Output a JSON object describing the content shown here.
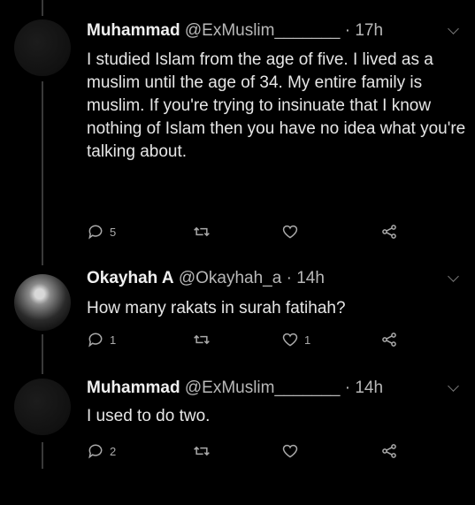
{
  "tweets": [
    {
      "name": "Muhammad",
      "handle": "@ExMuslim_______",
      "dot": "·",
      "time": "17h",
      "text": "I studied Islam from the age of five.  I lived as a muslim until the age of 34.  My entire family is muslim.  If you're trying to insinuate that I know nothing of Islam then you have no idea what you're talking about.",
      "reply_count": "5",
      "retweet_count": "",
      "like_count": ""
    },
    {
      "name": "Okayhah A",
      "handle": "@Okayhah_a",
      "dot": "·",
      "time": "14h",
      "text": "How many rakats in surah fatihah?",
      "reply_count": "1",
      "retweet_count": "",
      "like_count": "1"
    },
    {
      "name": "Muhammad",
      "handle": "@ExMuslim_______",
      "dot": "·",
      "time": "14h",
      "text": "I used to do two.",
      "reply_count": "2",
      "retweet_count": "",
      "like_count": ""
    }
  ],
  "icons": {
    "reply": "reply-icon",
    "retweet": "retweet-icon",
    "like": "heart-icon",
    "share": "share-icon",
    "more": "chevron-down-icon"
  }
}
